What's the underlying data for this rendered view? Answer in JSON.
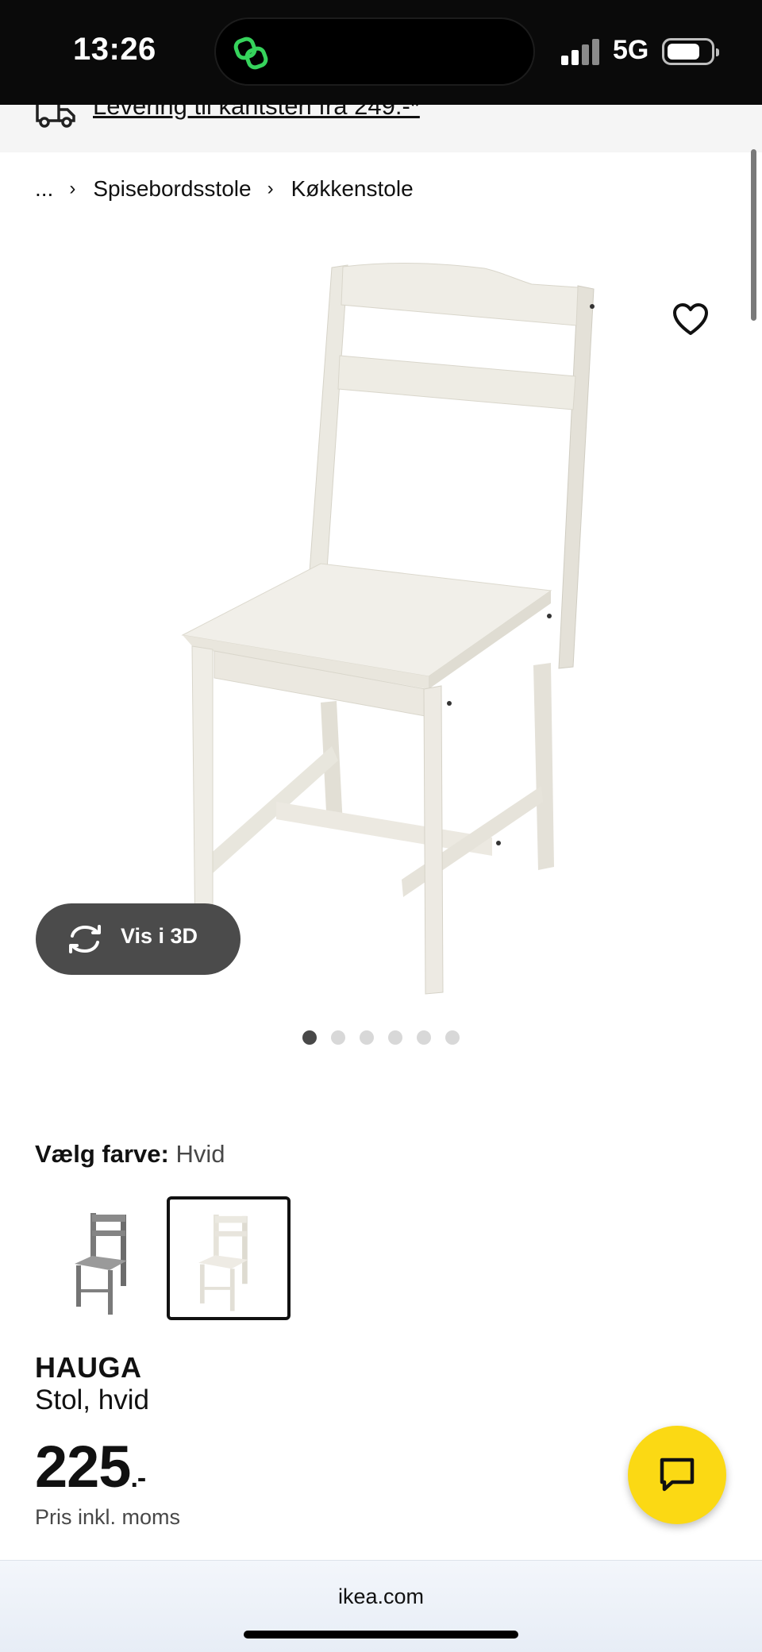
{
  "status_bar": {
    "time": "13:26",
    "network": "5G"
  },
  "delivery_banner": {
    "text": "Levering til kantsten fra 249.-*"
  },
  "breadcrumb": {
    "ellipsis": "...",
    "items": [
      "Spisebordsstole",
      "Køkkenstole"
    ]
  },
  "gallery": {
    "view_3d_label": "Vis i 3D",
    "image_count": 6,
    "active_index": 0
  },
  "color_picker": {
    "label": "Vælg farve:",
    "selected": "Hvid",
    "options": [
      "grå",
      "Hvid"
    ]
  },
  "product": {
    "name": "HAUGA",
    "description": "Stol, hvid",
    "price": "225",
    "price_suffix": ".-",
    "price_note": "Pris inkl. moms"
  },
  "browser": {
    "url": "ikea.com"
  },
  "colors": {
    "accent_yellow": "#fbd914",
    "button_dark": "#4b4b4b"
  }
}
